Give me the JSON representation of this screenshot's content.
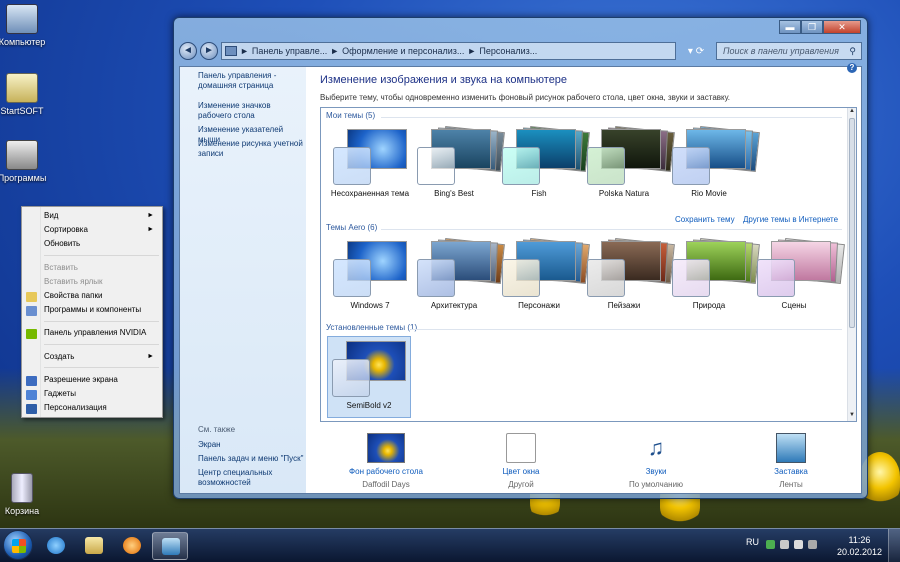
{
  "desktop": {
    "icons": [
      {
        "label": "Компьютер"
      },
      {
        "label": "StartSOFT"
      },
      {
        "label": "Программы"
      },
      {
        "label": "Корзина"
      }
    ]
  },
  "context_menu": {
    "items": [
      {
        "label": "Вид",
        "submenu": true
      },
      {
        "label": "Сортировка",
        "submenu": true
      },
      {
        "label": "Обновить"
      },
      {
        "label": "Вставить",
        "disabled": true
      },
      {
        "label": "Вставить ярлык",
        "disabled": true
      },
      {
        "label": "Свойства папки"
      },
      {
        "label": "Программы и компоненты"
      },
      {
        "label": "Панель управления NVIDIA"
      },
      {
        "label": "Создать",
        "submenu": true
      },
      {
        "label": "Разрешение экрана"
      },
      {
        "label": "Гаджеты"
      },
      {
        "label": "Персонализация"
      }
    ],
    "submenu_arrow": "►"
  },
  "window": {
    "buttons": {
      "minimize": "▬",
      "maximize": "❐",
      "close": "✕"
    },
    "nav": {
      "back": "◄",
      "forward": "►"
    },
    "breadcrumb": [
      "Панель управле...",
      "Оформление и персонализ...",
      "Персонализ..."
    ],
    "breadcrumb_sep": "►",
    "dropdown_glyph": "▾",
    "refresh_glyph": "⟳",
    "search_placeholder": "Поиск в панели управления",
    "search_icon": "⚲",
    "sidebar": {
      "links": [
        "Панель управления - домашняя страница",
        "Изменение значков рабочего стола",
        "Изменение указателей мыши",
        "Изменение рисунка учетной записи"
      ],
      "see_also_heading": "См. также",
      "see_also": [
        "Экран",
        "Панель задач и меню \"Пуск\"",
        "Центр специальных возможностей"
      ]
    },
    "main": {
      "title": "Изменение изображения и звука на компьютере",
      "subtitle": "Выберите тему, чтобы одновременно изменить фоновый рисунок рабочего стола, цвет окна, звуки и заставку.",
      "help": "?",
      "sections": {
        "my": {
          "heading": "Мои темы (5)",
          "themes": [
            "Несохраненная тема",
            "Bing's Best",
            "Fish",
            "Polska Natura",
            "Rio Movie"
          ],
          "links": [
            "Сохранить тему",
            "Другие темы в Интернете"
          ]
        },
        "aero": {
          "heading": "Темы Aero (6)",
          "themes": [
            "Windows 7",
            "Архитектура",
            "Персонажи",
            "Пейзажи",
            "Природа",
            "Сцены"
          ]
        },
        "installed": {
          "heading": "Установленные темы (1)",
          "themes": [
            "SemiBold v2"
          ]
        }
      },
      "scroll_glyphs": {
        "up": "▲",
        "down": "▼"
      },
      "bottom": [
        {
          "label": "Фон рабочего стола",
          "sub": "Daffodil Days"
        },
        {
          "label": "Цвет окна",
          "sub": "Другой"
        },
        {
          "label": "Звуки",
          "sub": "По умолчанию"
        },
        {
          "label": "Заставка",
          "sub": "Ленты"
        }
      ]
    }
  },
  "taskbar": {
    "lang": "RU",
    "time": "11:26",
    "date": "20.02.2012"
  },
  "colors": {
    "accent_link": "#0f5cbd",
    "title": "#1e3287"
  }
}
